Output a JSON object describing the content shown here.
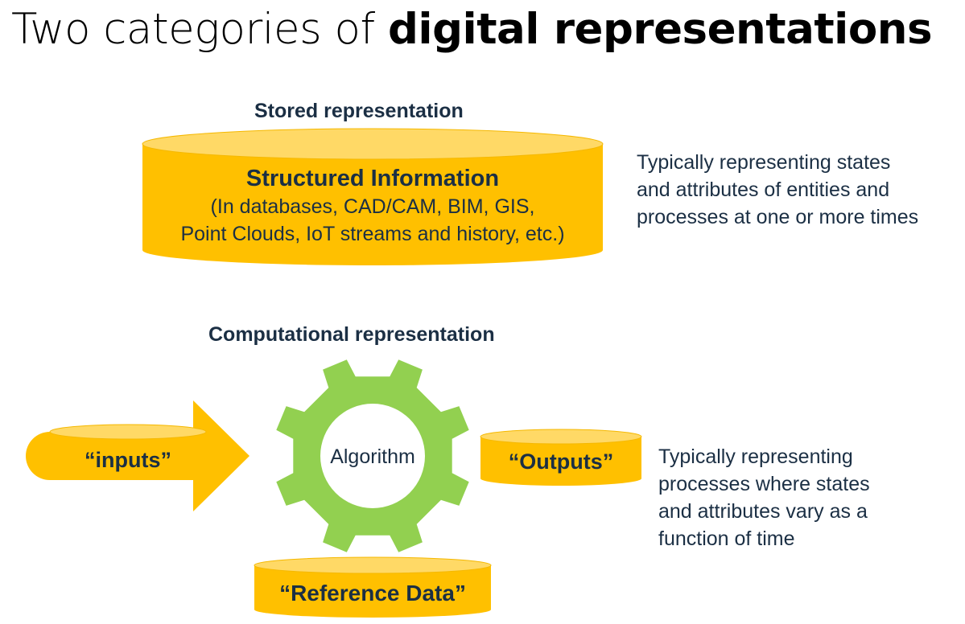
{
  "title": {
    "plain": "Two categories of ",
    "bold": "digital representations"
  },
  "stored": {
    "heading": "Stored representation",
    "cylinder_title": "Structured Information",
    "cylinder_lines": [
      "(In databases, CAD/CAM, BIM, GIS,",
      "Point Clouds, IoT streams and history, etc.)"
    ],
    "description_lines": [
      "Typically representing states",
      "and attributes of entities and",
      "processes at one or more times"
    ]
  },
  "computational": {
    "heading": "Computational representation",
    "inputs_label": "“inputs”",
    "algorithm_label": "Algorithm",
    "outputs_label": "“Outputs”",
    "reference_label": "“Reference Data”",
    "description_lines": [
      "Typically representing",
      "processes where states",
      "and attributes vary as a",
      "function of time"
    ]
  },
  "colors": {
    "cylinder_fill": "#ffc000",
    "cylinder_top": "#ffd966",
    "gear_fill": "#92d050",
    "heading_text": "#1b2f44"
  }
}
